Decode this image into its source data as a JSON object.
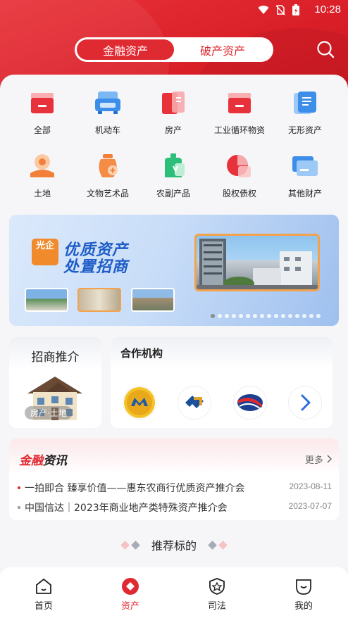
{
  "status": {
    "time": "10:28"
  },
  "segments": [
    {
      "label": "金融资产",
      "active": true
    },
    {
      "label": "破产资产",
      "active": false
    }
  ],
  "categories": [
    {
      "label": "全部",
      "icon": "all-icon"
    },
    {
      "label": "机动车",
      "icon": "car-icon"
    },
    {
      "label": "房产",
      "icon": "house-icon"
    },
    {
      "label": "工业循环物资",
      "icon": "industrial-icon"
    },
    {
      "label": "无形资产",
      "icon": "intangible-icon"
    },
    {
      "label": "土地",
      "icon": "land-icon"
    },
    {
      "label": "文物艺术品",
      "icon": "artwork-icon"
    },
    {
      "label": "农副产品",
      "icon": "agri-icon"
    },
    {
      "label": "股权债权",
      "icon": "equity-icon"
    },
    {
      "label": "其他财产",
      "icon": "other-icon"
    }
  ],
  "banner": {
    "badge": "光企",
    "line1": "优质资产",
    "line2": "处置招商",
    "dot_count": 16,
    "active_dot": 0
  },
  "invest": {
    "title": "招商推介",
    "tag": "房产·土地"
  },
  "partners": {
    "title": "合作机构"
  },
  "news": {
    "brand_red": "金融",
    "brand_dark": "资讯",
    "more": "更多",
    "items": [
      {
        "text": "一拍即合 臻享价值——惠东农商行优质资产推介会",
        "date": "2023-08-11"
      },
      {
        "text": "中国信达｜2023年商业地产类特殊资产推介会",
        "date": "2023-07-07"
      }
    ]
  },
  "recommend": {
    "title": "推荐标的"
  },
  "tabs": [
    {
      "label": "首页",
      "icon": "home-icon",
      "active": false
    },
    {
      "label": "资产",
      "icon": "asset-icon",
      "active": true
    },
    {
      "label": "司法",
      "icon": "justice-icon",
      "active": false
    },
    {
      "label": "我的",
      "icon": "profile-icon",
      "active": false
    }
  ],
  "colors": {
    "brand": "#e02a32",
    "banner_blue": "#1e5cc7"
  }
}
